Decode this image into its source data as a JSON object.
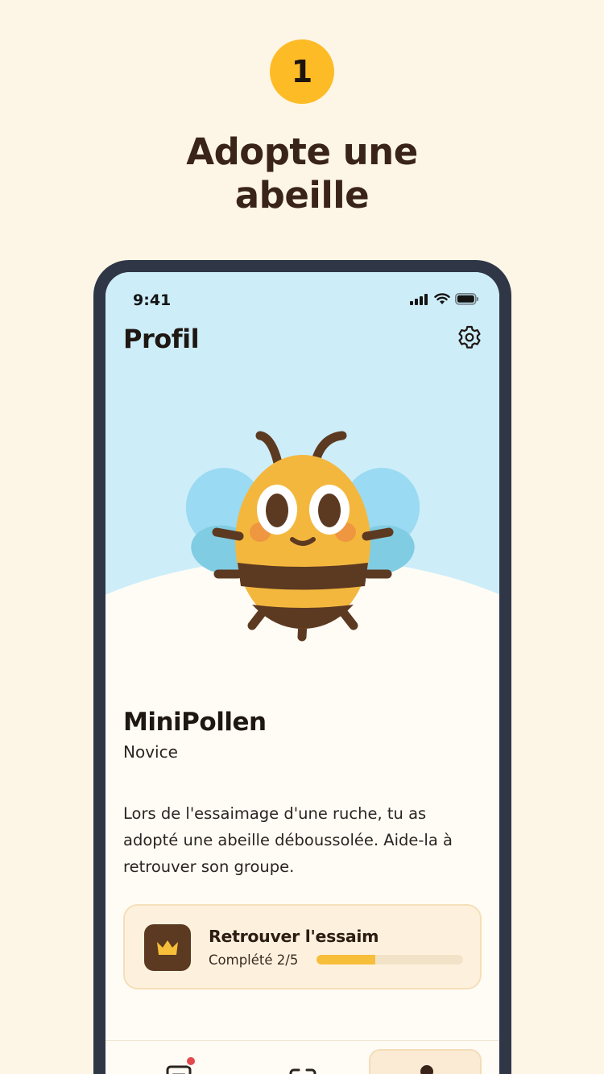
{
  "step": {
    "number": "1"
  },
  "headline": {
    "line1": "Adopte une",
    "line2": "abeille"
  },
  "status_bar": {
    "time": "9:41"
  },
  "header": {
    "title": "Profil",
    "settings_icon": "gear-icon"
  },
  "profile": {
    "name": "MiniPollen",
    "rank": "Novice",
    "story": "Lors de l'essaimage d'une ruche, tu as adopté une abeille déboussolée. Aide-la à retrouver son groupe."
  },
  "quest": {
    "icon": "crown-icon",
    "title": "Retrouver l'essaim",
    "progress_label": "Complété 2/5",
    "progress_value": 2,
    "progress_total": 5
  },
  "tabs": [
    {
      "name": "tab-journal",
      "icon": "journal-icon",
      "badge": true,
      "active": false
    },
    {
      "name": "tab-scan",
      "icon": "scan-icon",
      "badge": false,
      "active": false
    },
    {
      "name": "tab-profile",
      "icon": "profile-icon",
      "badge": false,
      "active": true
    }
  ],
  "colors": {
    "background": "#FDF6E6",
    "accent": "#FDBB26",
    "phone_frame": "#2F3646",
    "sky": "#CDEDF9",
    "progress": "#F7BE3A",
    "notification": "#E5484D"
  }
}
